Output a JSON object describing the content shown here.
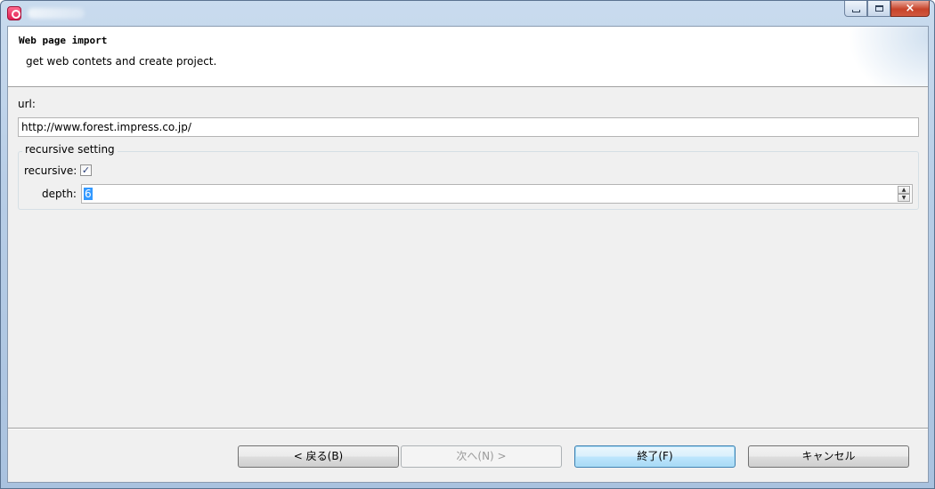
{
  "window": {
    "title": "",
    "controls": {
      "minimize": "",
      "maximize": "",
      "close": "×"
    }
  },
  "banner": {
    "title": "Web page import",
    "description": "get web contets and create project."
  },
  "form": {
    "url_label": "url:",
    "url_value": "http://www.forest.impress.co.jp/",
    "group_label": "recursive setting",
    "recursive_label": "recursive:",
    "recursive_checked": true,
    "checkmark": "✓",
    "depth_label": "depth:",
    "depth_value": "6",
    "spin_up": "▲",
    "spin_down": "▼"
  },
  "buttons": {
    "back": "< 戻る(B)",
    "next": "次へ(N) >",
    "finish": "終了(F)",
    "cancel": "キャンセル"
  },
  "icons": {
    "app": "app-logo-icon",
    "minimize": "minimize-icon",
    "maximize": "maximize-icon",
    "close": "close-icon"
  }
}
